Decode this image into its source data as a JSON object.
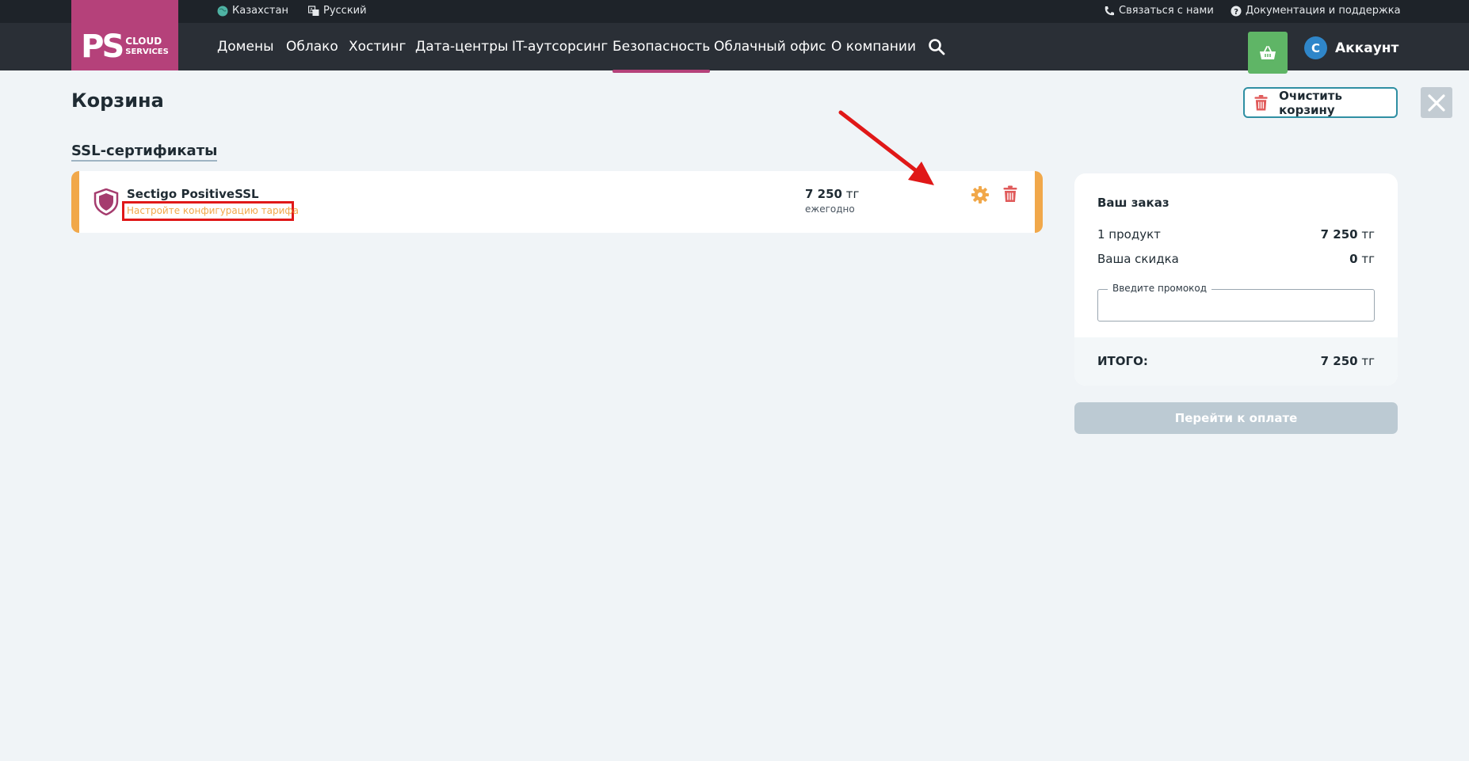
{
  "topbar": {
    "region": "Казахстан",
    "language": "Русский",
    "contact": "Связаться с нами",
    "docs": "Документация и поддержка"
  },
  "logo": {
    "ps": "PS",
    "line1": "CLOUD",
    "line2": "SERVICES"
  },
  "nav": {
    "items": [
      "Домены",
      "Облако",
      "Хостинг",
      "Дата-центры",
      "IT-аутсорсинг",
      "Безопасность",
      "Облачный офис",
      "О компании"
    ],
    "active": "Безопасность"
  },
  "account": {
    "initial": "С",
    "label": "Аккаунт"
  },
  "page": {
    "title": "Корзина",
    "clear_cart": "Очистить корзину",
    "section_title": "SSL-сертификаты"
  },
  "product": {
    "name": "Sectigo PositiveSSL",
    "config_hint": "Настройте конфигурацию тарифа",
    "price": "7 250",
    "currency": "тг",
    "period": "ежегодно"
  },
  "order": {
    "title": "Ваш заказ",
    "products_label": "1 продукт",
    "products_value": "7 250",
    "discount_label": "Ваша скидка",
    "discount_value": "0",
    "currency": "тг",
    "promo_placeholder": "Введите промокод",
    "total_label": "ИТОГО:",
    "total_value": "7 250",
    "pay_button": "Перейти к оплате"
  },
  "colors": {
    "brand": "#b5417a",
    "accent_orange": "#f1a84a",
    "cart_green": "#5fb566",
    "annotation_red": "#e01818"
  },
  "icons": [
    "globe-icon",
    "translate-icon",
    "phone-icon",
    "help-icon",
    "search-icon",
    "basket-icon",
    "trash-icon",
    "close-icon",
    "shield-icon",
    "gear-icon",
    "arrow-annotation"
  ]
}
